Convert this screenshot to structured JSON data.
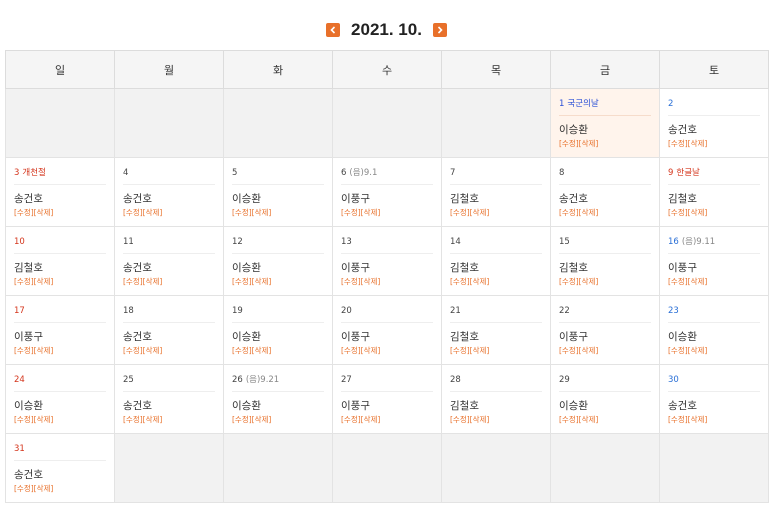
{
  "title": "2021. 10.",
  "weekdays": [
    "일",
    "월",
    "화",
    "수",
    "목",
    "금",
    "토"
  ],
  "edit_label": "[수정]",
  "delete_label": "[삭제]",
  "days": {
    "d1": {
      "num": "1",
      "holiday": "국군의날",
      "name": "이승환"
    },
    "d2": {
      "num": "2",
      "name": "송건호"
    },
    "d3": {
      "num": "3",
      "holiday": "개천절",
      "name": "송건호"
    },
    "d4": {
      "num": "4",
      "name": "송건호"
    },
    "d5": {
      "num": "5",
      "name": "이승환"
    },
    "d6": {
      "num": "6",
      "lunar": "(음)9.1",
      "name": "이풍구"
    },
    "d7": {
      "num": "7",
      "name": "김철호"
    },
    "d8": {
      "num": "8",
      "name": "송건호"
    },
    "d9": {
      "num": "9",
      "holiday": "한글날",
      "name": "김철호"
    },
    "d10": {
      "num": "10",
      "name": "김철호"
    },
    "d11": {
      "num": "11",
      "name": "송건호"
    },
    "d12": {
      "num": "12",
      "name": "이승환"
    },
    "d13": {
      "num": "13",
      "name": "이풍구"
    },
    "d14": {
      "num": "14",
      "name": "김철호"
    },
    "d15": {
      "num": "15",
      "name": "김철호"
    },
    "d16": {
      "num": "16",
      "lunar": "(음)9.11",
      "name": "이풍구"
    },
    "d17": {
      "num": "17",
      "name": "이풍구"
    },
    "d18": {
      "num": "18",
      "name": "송건호"
    },
    "d19": {
      "num": "19",
      "name": "이승환"
    },
    "d20": {
      "num": "20",
      "name": "이풍구"
    },
    "d21": {
      "num": "21",
      "name": "김철호"
    },
    "d22": {
      "num": "22",
      "name": "이풍구"
    },
    "d23": {
      "num": "23",
      "name": "이승환"
    },
    "d24": {
      "num": "24",
      "name": "이승환"
    },
    "d25": {
      "num": "25",
      "name": "송건호"
    },
    "d26": {
      "num": "26",
      "lunar": "(음)9.21",
      "name": "이승환"
    },
    "d27": {
      "num": "27",
      "name": "이풍구"
    },
    "d28": {
      "num": "28",
      "name": "김철호"
    },
    "d29": {
      "num": "29",
      "name": "이승환"
    },
    "d30": {
      "num": "30",
      "name": "송건호"
    },
    "d31": {
      "num": "31",
      "name": "송건호"
    }
  },
  "colors": {
    "accent": "#e8702a",
    "sunday": "#d4351c",
    "saturday": "#2a6fd6",
    "today_bg": "#fff4ec"
  },
  "icons": {
    "prev": "chevron-left-icon",
    "next": "chevron-right-icon"
  }
}
